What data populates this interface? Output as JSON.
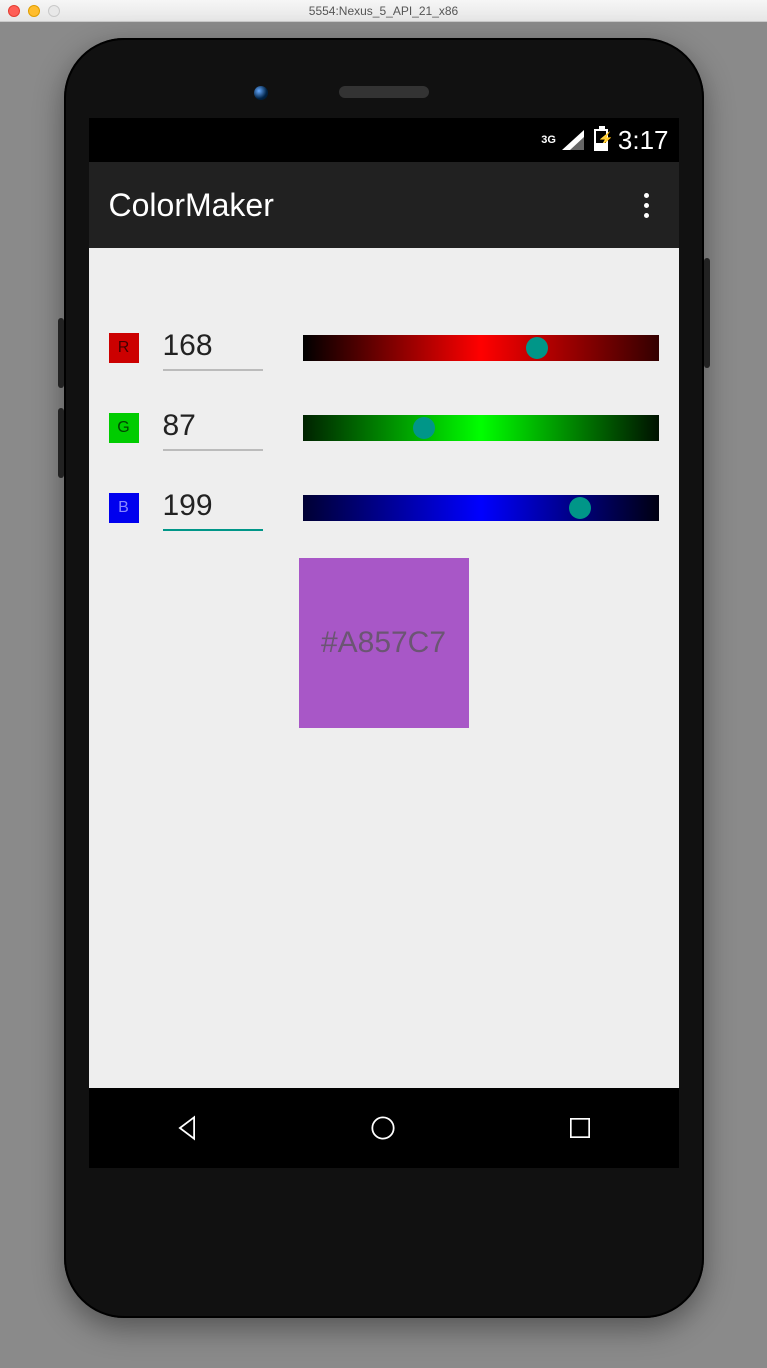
{
  "emulator": {
    "window_title": "5554:Nexus_5_API_21_x86"
  },
  "status_bar": {
    "network": "3G",
    "time": "3:17"
  },
  "app_bar": {
    "title": "ColorMaker"
  },
  "channels": {
    "r": {
      "label": "R",
      "value": "168",
      "percent": 65.9
    },
    "g": {
      "label": "G",
      "value": "87",
      "percent": 34.1
    },
    "b": {
      "label": "B",
      "value": "199",
      "percent": 78.0
    }
  },
  "swatch": {
    "hex": "#A857C7",
    "bg": "#A857C7"
  }
}
